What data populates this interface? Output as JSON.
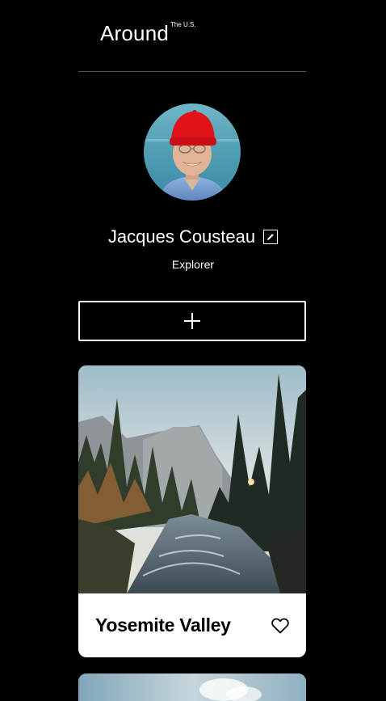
{
  "header": {
    "logo_text": "Around",
    "logo_superscript": "The U.S."
  },
  "profile": {
    "name": "Jacques Cousteau",
    "role": "Explorer",
    "avatar_icon": "avatar-photo",
    "edit_icon": "pencil-icon"
  },
  "add_button": {
    "icon": "plus-icon"
  },
  "cards": [
    {
      "title": "Yosemite Valley",
      "like_icon": "heart-outline-icon"
    },
    {
      "title": "",
      "like_icon": "heart-outline-icon"
    }
  ],
  "colors": {
    "background": "#000000",
    "text": "#ffffff",
    "card_background": "#ffffff",
    "card_text": "#000000",
    "divider": "#555555"
  }
}
